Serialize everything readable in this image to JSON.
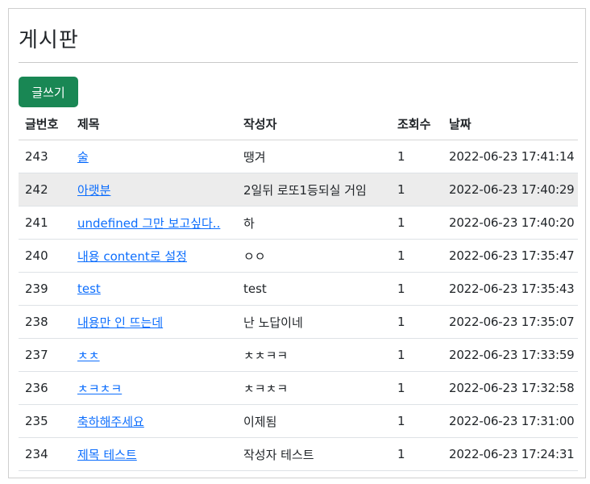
{
  "page": {
    "title": "게시판"
  },
  "toolbar": {
    "write_label": "글쓰기"
  },
  "colors": {
    "button": "#198754",
    "link": "#0d6efd",
    "hover_row": "#ececec"
  },
  "table": {
    "headers": {
      "num": "글번호",
      "title": "제목",
      "author": "작성자",
      "views": "조회수",
      "date": "날짜"
    },
    "rows": [
      {
        "num": "243",
        "title": "술",
        "author": "땡겨",
        "views": "1",
        "date": "2022-06-23 17:41:14"
      },
      {
        "num": "242",
        "title": "아랫분",
        "author": "2일뒤 로또1등되실 거임",
        "views": "1",
        "date": "2022-06-23 17:40:29"
      },
      {
        "num": "241",
        "title": "undefined 그만 보고싶다..",
        "author": "하",
        "views": "1",
        "date": "2022-06-23 17:40:20"
      },
      {
        "num": "240",
        "title": "내용 content로 설정",
        "author": "ㅇㅇ",
        "views": "1",
        "date": "2022-06-23 17:35:47"
      },
      {
        "num": "239",
        "title": "test",
        "author": "test",
        "views": "1",
        "date": "2022-06-23 17:35:43"
      },
      {
        "num": "238",
        "title": "내용만 인 뜨는데",
        "author": "난 노답이네",
        "views": "1",
        "date": "2022-06-23 17:35:07"
      },
      {
        "num": "237",
        "title": "ㅊㅊ",
        "author": "ㅊㅊㅋㅋ",
        "views": "1",
        "date": "2022-06-23 17:33:59"
      },
      {
        "num": "236",
        "title": "ㅊㅋㅊㅋ",
        "author": "ㅊㅋㅊㅋ",
        "views": "1",
        "date": "2022-06-23 17:32:58"
      },
      {
        "num": "235",
        "title": "축하해주세요",
        "author": "이제됨",
        "views": "1",
        "date": "2022-06-23 17:31:00"
      },
      {
        "num": "234",
        "title": "제목 테스트",
        "author": "작성자 테스트",
        "views": "1",
        "date": "2022-06-23 17:24:31"
      }
    ]
  }
}
